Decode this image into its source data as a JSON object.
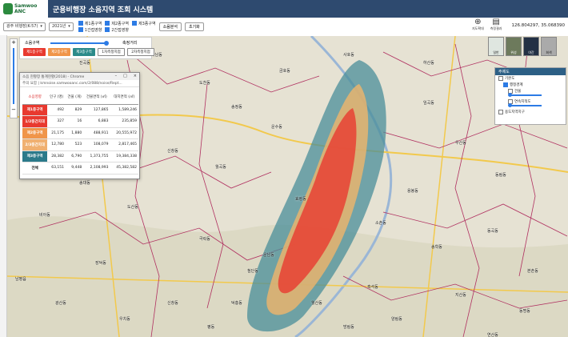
{
  "header": {
    "logo_text": "Samwoo ANC",
    "title": "군용비행장 소음지역 조회 시스템"
  },
  "toolbar": {
    "airfield_select": "광주 비행장(K-57)",
    "year_select": "2021년",
    "checkboxes": [
      {
        "label": "제1종구역",
        "checked": true
      },
      {
        "label": "제2종구역",
        "checked": true
      },
      {
        "label": "제3종구역",
        "checked": true
      },
      {
        "label": "1간접영향",
        "checked": true
      },
      {
        "label": "2간접영향",
        "checked": true
      }
    ],
    "btn_noise": "소음분석",
    "btn_reset": "초기화",
    "coords": "126.804297, 35.068390"
  },
  "tools": [
    {
      "label": "지도확대",
      "icon": "magnifier-plus-icon"
    },
    {
      "label": "측정결과",
      "icon": "document-icon"
    }
  ],
  "radius_panel": {
    "noise_label": "소음구역",
    "distance_label": "축정거리",
    "buttons": [
      {
        "label": "제1종구역",
        "color": "#e8392f"
      },
      {
        "label": "제2종구역",
        "color": "#f0954a"
      },
      {
        "label": "제3종구역",
        "color": "#2b8a8a"
      },
      {
        "label": "1차측정지점",
        "color": "#444444"
      },
      {
        "label": "2차측정지점",
        "color": "#444444"
      }
    ]
  },
  "popup": {
    "window_title": "소음 현황창 통계현황(2018) - Chrome",
    "url": "주의 요함 | kmnoise.samwooanc.com/2/088/noise/Rept...",
    "headers": [
      "소음영향",
      "인구\n(명)",
      "건물\n(개)",
      "건물면적\n(㎡)",
      "대지면적\n(㎡)"
    ],
    "rows": [
      {
        "zone": "제1종구역",
        "color": "#e8392f",
        "pop": "492",
        "bld": "829",
        "barea": "127,865",
        "larea": "1,589,246"
      },
      {
        "zone": "1/2중간지대",
        "color": "#e8392f",
        "pop": "327",
        "bld": "16",
        "barea": "6,883",
        "larea": "235,859"
      },
      {
        "zone": "제2종구역",
        "color": "#f0954a",
        "pop": "21,175",
        "bld": "1,880",
        "barea": "488,911",
        "larea": "20,555,972"
      },
      {
        "zone": "2/3중간지대",
        "color": "#f0b070",
        "pop": "12,780",
        "bld": "523",
        "barea": "108,079",
        "larea": "2,817,465"
      },
      {
        "zone": "제3종구역",
        "color": "#2b7a8a",
        "pop": "28,382",
        "bld": "6,790",
        "barea": "1,373,755",
        "larea": "19,384,338"
      },
      {
        "zone": "전체",
        "color": "#ffffff",
        "pop": "63,151",
        "bld": "9,448",
        "barea": "2,108,993",
        "larea": "45,382,582"
      }
    ]
  },
  "layer_panel": {
    "title": "주제도",
    "items": [
      {
        "label": "기본도",
        "checked": false
      },
      {
        "label": "행정경계",
        "checked": true
      },
      {
        "label": "건물",
        "checked": false
      },
      {
        "label": "연속지적도",
        "checked": false
      },
      {
        "label": "용도지역지구",
        "checked": false
      }
    ]
  },
  "thumbnails": [
    "일반",
    "위성",
    "야간",
    "회색"
  ],
  "map_labels": [
    "진곡동",
    "하남동",
    "도천동",
    "남산동",
    "송정동",
    "선운동",
    "운수동",
    "신가동",
    "신창동",
    "월곡동",
    "송대동",
    "효령동",
    "도산동",
    "비아동",
    "극락동",
    "운남동",
    "장덕동",
    "첨단동",
    "임곡동",
    "우산동",
    "동림동",
    "용봉동",
    "소촌동",
    "송학동",
    "동곡동",
    "본촌동",
    "흑석동",
    "지산동",
    "동명동",
    "양림동",
    "월산동",
    "방림동",
    "신창동",
    "광산동",
    "덕흥동",
    "우치동",
    "평동",
    "연산동",
    "요기동",
    "하산동",
    "사호동",
    "금호동",
    "노안면",
    "남평읍"
  ]
}
